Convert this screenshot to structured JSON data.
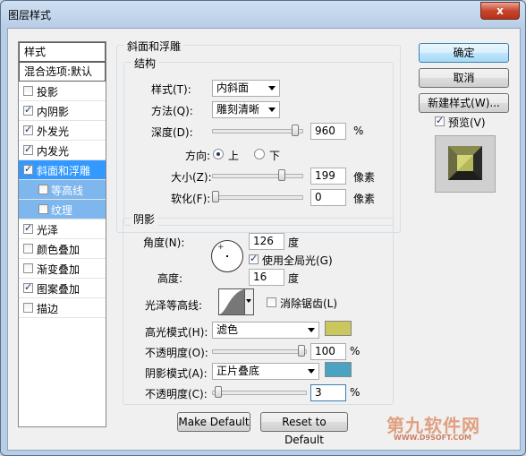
{
  "window": {
    "title": "图层样式",
    "close_label": "x"
  },
  "sidebar": {
    "header": "样式",
    "blend_header": "混合选项:默认",
    "items": [
      {
        "label": "投影",
        "checked": false
      },
      {
        "label": "内阴影",
        "checked": true
      },
      {
        "label": "外发光",
        "checked": true
      },
      {
        "label": "内发光",
        "checked": true
      },
      {
        "label": "斜面和浮雕",
        "checked": true,
        "selected": true
      },
      {
        "label": "等高线",
        "checked": false,
        "sub": true
      },
      {
        "label": "纹理",
        "checked": false,
        "sub": true
      },
      {
        "label": "光泽",
        "checked": true
      },
      {
        "label": "颜色叠加",
        "checked": false
      },
      {
        "label": "渐变叠加",
        "checked": false
      },
      {
        "label": "图案叠加",
        "checked": true
      },
      {
        "label": "描边",
        "checked": false
      }
    ]
  },
  "bevel": {
    "section_title": "斜面和浮雕",
    "structure_title": "结构",
    "style_label": "样式(T):",
    "style_value": "内斜面",
    "technique_label": "方法(Q):",
    "technique_value": "雕刻清晰",
    "depth_label": "深度(D):",
    "depth_value": "960",
    "depth_unit": "%",
    "depth_fraction": 0.97,
    "direction_label": "方向:",
    "direction_up": "上",
    "direction_down": "下",
    "size_label": "大小(Z):",
    "size_value": "199",
    "size_unit": "像素",
    "size_fraction": 0.8,
    "soften_label": "软化(F):",
    "soften_value": "0",
    "soften_unit": "像素",
    "soften_fraction": 0.0
  },
  "shading": {
    "title": "阴影",
    "angle_label": "角度(N):",
    "angle_value": "126",
    "angle_unit": "度",
    "global_light_label": "使用全局光(G)",
    "global_light_checked": true,
    "altitude_label": "高度:",
    "altitude_value": "16",
    "altitude_unit": "度",
    "gloss_label": "光泽等高线:",
    "antialias_label": "消除锯齿(L)",
    "antialias_checked": false,
    "highlight_mode_label": "高光模式(H):",
    "highlight_mode_value": "滤色",
    "highlight_color": "#c9c75e",
    "highlight_opacity_label": "不透明度(O):",
    "highlight_opacity_value": "100",
    "highlight_opacity_unit": "%",
    "highlight_opacity_fraction": 1.0,
    "shadow_mode_label": "阴影模式(A):",
    "shadow_mode_value": "正片叠底",
    "shadow_color": "#4ba3c3",
    "shadow_opacity_label": "不透明度(C):",
    "shadow_opacity_value": "3",
    "shadow_opacity_unit": "%",
    "shadow_opacity_fraction": 0.03
  },
  "footer": {
    "make_default": "Make Default",
    "reset_default": "Reset to Default"
  },
  "buttons": {
    "ok": "确定",
    "cancel": "取消",
    "new_style": "新建样式(W)...",
    "preview_label": "预览(V)",
    "preview_checked": true
  },
  "watermark": {
    "line1": "第九软件网",
    "line2": "WWW.D9SOFT.COM"
  }
}
